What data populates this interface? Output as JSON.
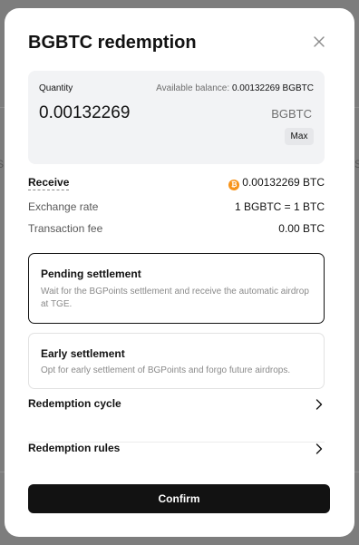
{
  "modal": {
    "title": "BGBTC redemption",
    "close_icon": "close-icon"
  },
  "quantity": {
    "label": "Quantity",
    "available_label": "Available balance:",
    "available_value": "0.00132269 BGBTC",
    "value": "0.00132269",
    "unit": "BGBTC",
    "max_label": "Max"
  },
  "details": {
    "receive_label": "Receive",
    "receive_icon": "bitcoin-icon",
    "receive_icon_glyph": "₿",
    "receive_value": "0.00132269 BTC",
    "rate_label": "Exchange rate",
    "rate_value": "1 BGBTC = 1 BTC",
    "fee_label": "Transaction fee",
    "fee_value": "0.00  BTC"
  },
  "options": [
    {
      "title": "Pending settlement",
      "description": "Wait for the BGPoints settlement and receive the automatic airdrop at TGE.",
      "selected": true
    },
    {
      "title": "Early settlement",
      "description": "Opt for early settlement of BGPoints and forgo future airdrops.",
      "selected": false
    }
  ],
  "links": [
    {
      "label": "Redemption cycle",
      "icon": "chevron-right-icon"
    },
    {
      "label": "Redemption rules",
      "icon": "chevron-right-icon"
    }
  ],
  "confirm_label": "Confirm",
  "colors": {
    "overlay": "#7d7d7d",
    "primary": "#121212",
    "input_bg": "#f2f3f5",
    "btc_orange": "#f7931a"
  }
}
